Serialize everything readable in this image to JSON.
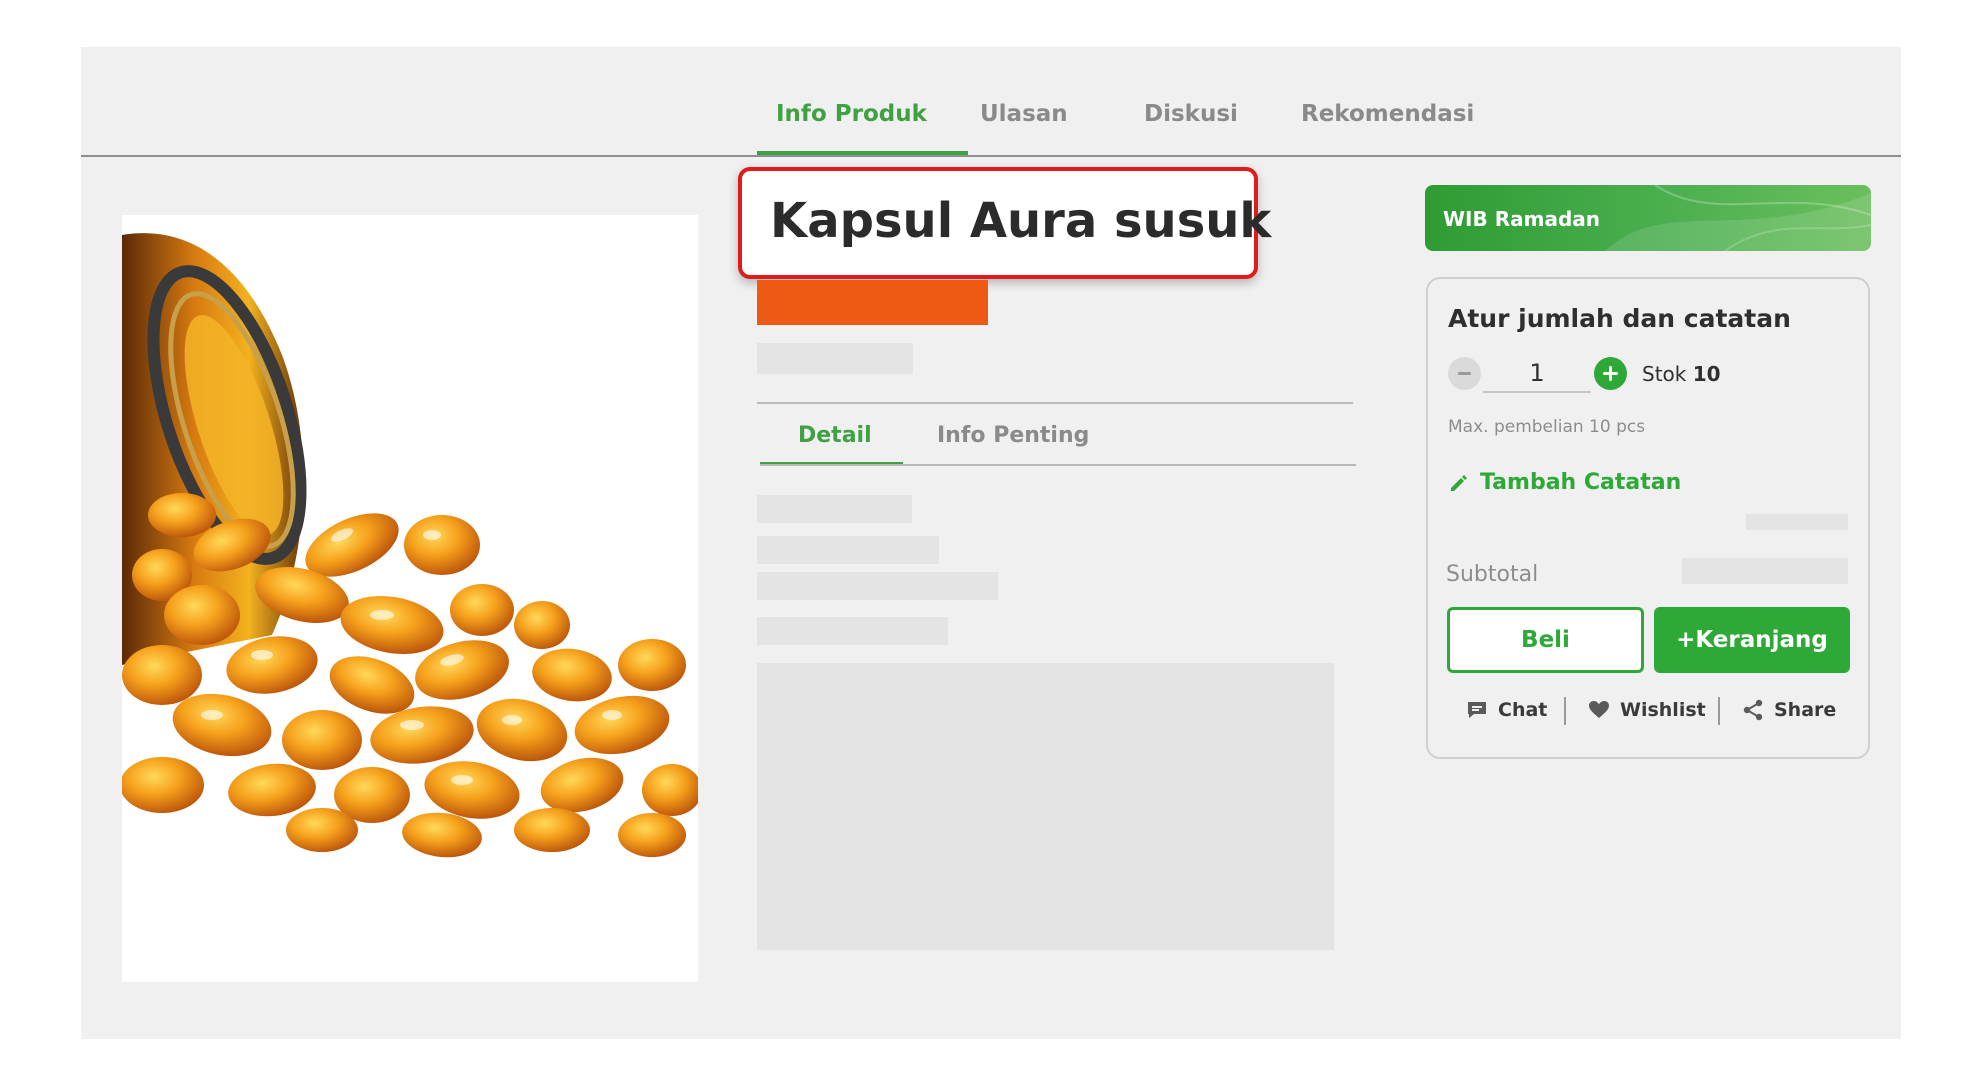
{
  "tabs": {
    "info_produk": "Info Produk",
    "ulasan": "Ulasan",
    "diskusi": "Diskusi",
    "rekomendasi": "Rekomendasi"
  },
  "product": {
    "title": "Kapsul Aura susuk",
    "price_color": "#ee5a14"
  },
  "detail_tabs": {
    "detail": "Detail",
    "info_penting": "Info Penting"
  },
  "promo": {
    "label": "WIB Ramadan"
  },
  "cart": {
    "title": "Atur jumlah dan catatan",
    "quantity": "1",
    "stock_label": "Stok",
    "stock_value": "10",
    "max_note": "Max. pembelian 10 pcs",
    "add_note": "Tambah Catatan",
    "subtotal_label": "Subtotal",
    "buy_label": "Beli",
    "cart_label": "+Keranjang"
  },
  "actions": {
    "chat": "Chat",
    "wishlist": "Wishlist",
    "share": "Share"
  },
  "colors": {
    "accent": "#2ea836",
    "highlight_border": "#e01b1b"
  }
}
